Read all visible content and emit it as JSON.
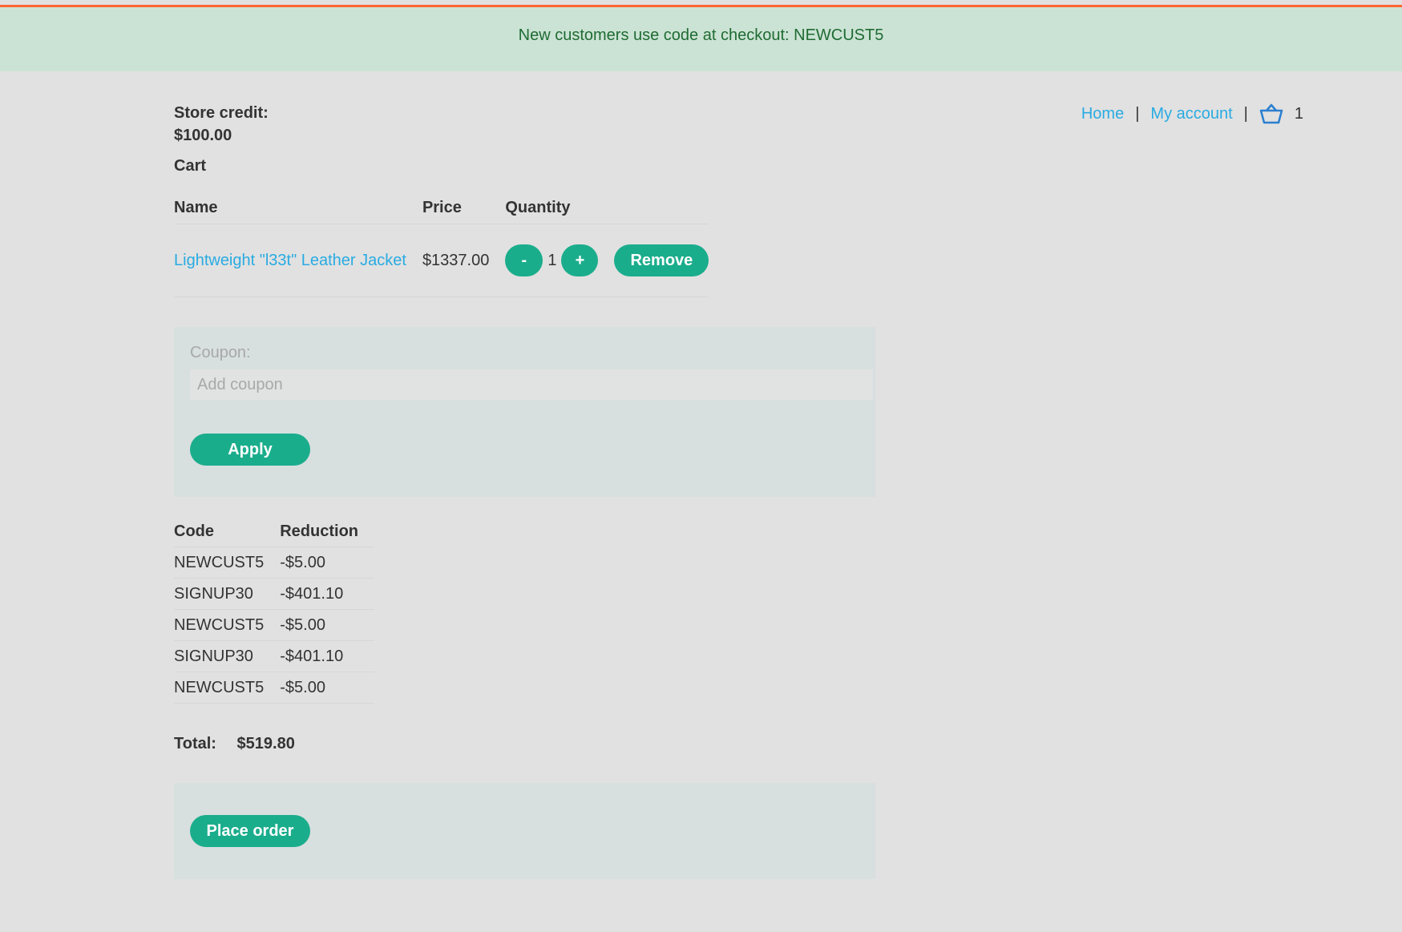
{
  "banner": {
    "text": "New customers use code at checkout: NEWCUST5"
  },
  "nav": {
    "home": "Home",
    "account": "My account",
    "separator": "|",
    "cart_count": "1"
  },
  "store_credit": {
    "label": "Store credit:",
    "amount": "$100.00"
  },
  "cart": {
    "title": "Cart",
    "headers": {
      "name": "Name",
      "price": "Price",
      "quantity": "Quantity"
    },
    "items": [
      {
        "name": "Lightweight \"l33t\" Leather Jacket",
        "price": "$1337.00",
        "quantity": "1",
        "minus": "-",
        "plus": "+",
        "remove": "Remove"
      }
    ]
  },
  "coupon": {
    "label": "Coupon:",
    "placeholder": "Add coupon",
    "apply": "Apply"
  },
  "reductions": {
    "headers": {
      "code": "Code",
      "reduction": "Reduction"
    },
    "rows": [
      {
        "code": "NEWCUST5",
        "amount": "-$5.00"
      },
      {
        "code": "SIGNUP30",
        "amount": "-$401.10"
      },
      {
        "code": "NEWCUST5",
        "amount": "-$5.00"
      },
      {
        "code": "SIGNUP30",
        "amount": "-$401.10"
      },
      {
        "code": "NEWCUST5",
        "amount": "-$5.00"
      }
    ]
  },
  "total": {
    "label": "Total:",
    "value": "$519.80"
  },
  "order": {
    "place": "Place order"
  },
  "colors": {
    "accent": "#1aad8c",
    "link": "#29abe2",
    "banner_bg": "#cbe3d4",
    "top_line": "#ff6633"
  }
}
